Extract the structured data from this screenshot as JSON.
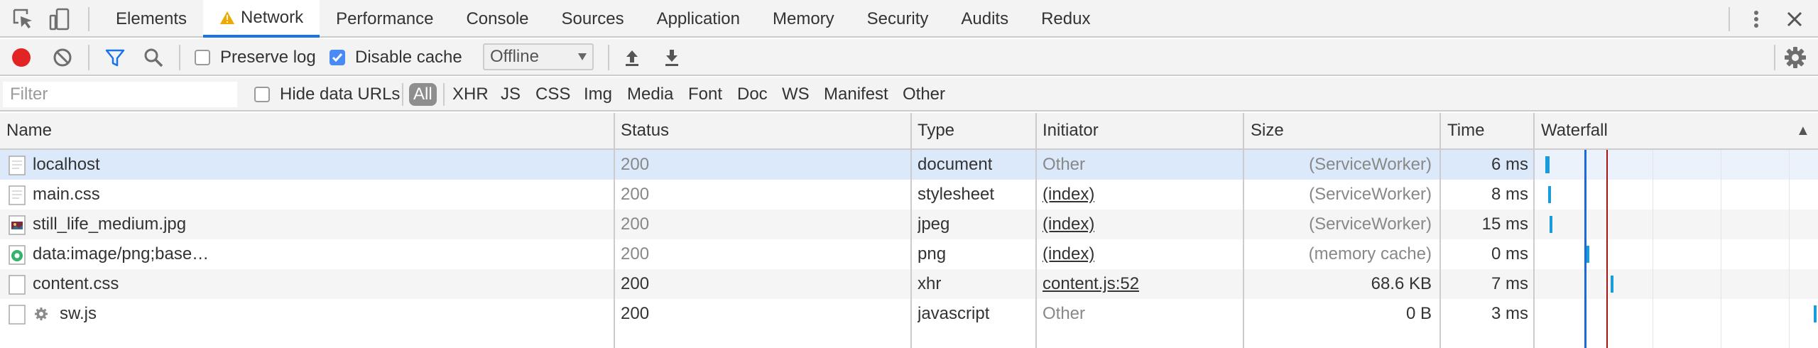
{
  "tabbar": {
    "tabs": [
      {
        "label": "Elements",
        "active": false,
        "warning": false
      },
      {
        "label": "Network",
        "active": true,
        "warning": true
      },
      {
        "label": "Performance",
        "active": false,
        "warning": false
      },
      {
        "label": "Console",
        "active": false,
        "warning": false
      },
      {
        "label": "Sources",
        "active": false,
        "warning": false
      },
      {
        "label": "Application",
        "active": false,
        "warning": false
      },
      {
        "label": "Memory",
        "active": false,
        "warning": false
      },
      {
        "label": "Security",
        "active": false,
        "warning": false
      },
      {
        "label": "Audits",
        "active": false,
        "warning": false
      },
      {
        "label": "Redux",
        "active": false,
        "warning": false
      }
    ],
    "icons": [
      "inspect-element-icon",
      "device-toolbar-icon",
      "more-options-icon",
      "close-icon"
    ]
  },
  "toolbar": {
    "preserve_log_label": "Preserve log",
    "preserve_log_checked": false,
    "disable_cache_label": "Disable cache",
    "disable_cache_checked": true,
    "throttle_value": "Offline",
    "icons": [
      "record-icon",
      "clear-icon",
      "filter-icon",
      "search-icon",
      "import-har-icon",
      "export-har-icon",
      "settings-gear-icon"
    ]
  },
  "filterbar": {
    "filter_placeholder": "Filter",
    "hide_data_urls_label": "Hide data URLs",
    "hide_data_urls_checked": false,
    "types": [
      "All",
      "XHR",
      "JS",
      "CSS",
      "Img",
      "Media",
      "Font",
      "Doc",
      "WS",
      "Manifest",
      "Other"
    ],
    "active_type": "All"
  },
  "table": {
    "columns": [
      "Name",
      "Status",
      "Type",
      "Initiator",
      "Size",
      "Time",
      "Waterfall"
    ],
    "sort_indicator": "▲",
    "rows": [
      {
        "name": "localhost",
        "status": "200",
        "type": "document",
        "initiator": "Other",
        "size": "(ServiceWorker)",
        "time": "6 ms",
        "icon": "document-file-icon",
        "selected": true
      },
      {
        "name": "main.css",
        "status": "200",
        "type": "stylesheet",
        "initiator": "(index)",
        "size": "(ServiceWorker)",
        "time": "8 ms",
        "icon": "stylesheet-file-icon",
        "selected": false
      },
      {
        "name": "still_life_medium.jpg",
        "status": "200",
        "type": "jpeg",
        "initiator": "(index)",
        "size": "(ServiceWorker)",
        "time": "15 ms",
        "icon": "image-file-icon",
        "selected": false
      },
      {
        "name": "data:image/png;base…",
        "status": "200",
        "type": "png",
        "initiator": "(index)",
        "size": "(memory cache)",
        "time": "0 ms",
        "icon": "data-url-icon",
        "selected": false
      },
      {
        "name": "content.css",
        "status": "200",
        "type": "xhr",
        "initiator": "content.js:52",
        "size": "68.6 KB",
        "time": "7 ms",
        "icon": "generic-file-icon",
        "selected": false
      },
      {
        "name": "sw.js",
        "status": "200",
        "type": "javascript",
        "initiator": "Other",
        "size": "0 B",
        "time": "3 ms",
        "icon": "service-worker-gear-icon",
        "selected": false
      }
    ]
  },
  "colors": {
    "accent": "#1a73e8",
    "record": "#e32424",
    "checkbox_checked": "#4a8af4",
    "selected_row": "#dce9fb",
    "waterfall_bar": "#1a9bdc",
    "dom_content_loaded_line": "#1a6ad8",
    "load_line": "#a31515"
  }
}
